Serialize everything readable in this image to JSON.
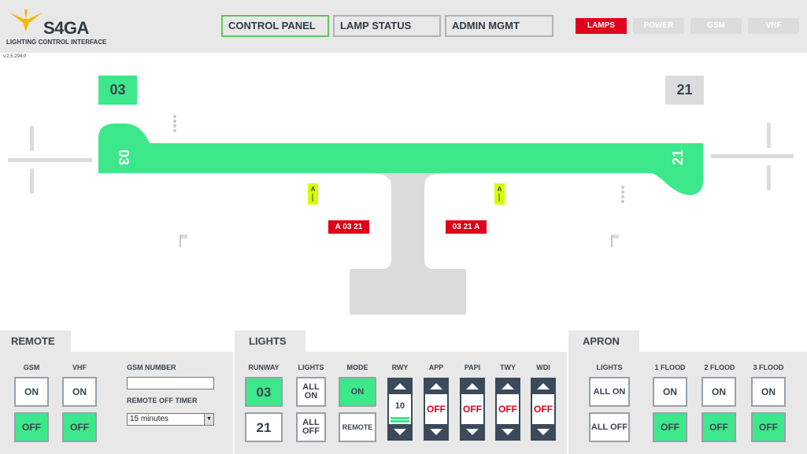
{
  "header": {
    "brand": "S4GA",
    "subtitle": "LIGHTING CONTROL INTERFACE",
    "version": "v.2.5.294.0",
    "nav": [
      {
        "label": "CONTROL PANEL",
        "active": true
      },
      {
        "label": "LAMP STATUS",
        "active": false
      },
      {
        "label": "ADMIN MGMT",
        "active": false
      }
    ],
    "tabs": [
      {
        "label": "LAMPS",
        "active": true
      },
      {
        "label": "POWER",
        "active": false
      },
      {
        "label": "GSM",
        "active": false
      },
      {
        "label": "VHF",
        "active": false
      }
    ]
  },
  "map": {
    "runway_left_label": "03",
    "runway_right_label": "21",
    "runway_end_left": "03",
    "runway_end_right": "21",
    "taxi_sign_left": "A 03 21",
    "taxi_sign_right": "03 21 A",
    "taxi_marker_left": "A",
    "taxi_marker_right": "A",
    "colors": {
      "runway": "#3de88a",
      "taxiway": "#dcdcdc",
      "sign": "#e0001b",
      "marker": "#d4ff00"
    }
  },
  "remote": {
    "title": "REMOTE",
    "gsm_label": "GSM",
    "vhf_label": "VHF",
    "gsm_on": "ON",
    "gsm_off": "OFF",
    "vhf_on": "ON",
    "vhf_off": "OFF",
    "gsm_number_label": "GSM NUMBER",
    "gsm_number_value": "",
    "remote_off_timer_label": "REMOTE OFF TIMER",
    "remote_off_timer_value": "15 minutes"
  },
  "lights": {
    "title": "LIGHTS",
    "runway_label": "RUNWAY",
    "lights_label": "LIGHTS",
    "mode_label": "MODE",
    "runway_03": "03",
    "runway_21": "21",
    "all_on": "ALL ON",
    "all_off": "ALL OFF",
    "mode_on": "ON",
    "mode_remote": "REMOTE",
    "steppers": [
      {
        "label": "RWY",
        "value": "10",
        "level": 0.2
      },
      {
        "label": "APP",
        "value": "OFF"
      },
      {
        "label": "PAPI",
        "value": "OFF"
      },
      {
        "label": "TWY",
        "value": "OFF"
      },
      {
        "label": "WDI",
        "value": "OFF"
      }
    ]
  },
  "apron": {
    "title": "APRON",
    "lights_label": "LIGHTS",
    "all_on": "ALL ON",
    "all_off": "ALL OFF",
    "flood1_label": "1 FLOOD",
    "flood2_label": "2 FLOOD",
    "flood3_label": "3 FLOOD",
    "on_label": "ON",
    "off_label": "OFF"
  }
}
